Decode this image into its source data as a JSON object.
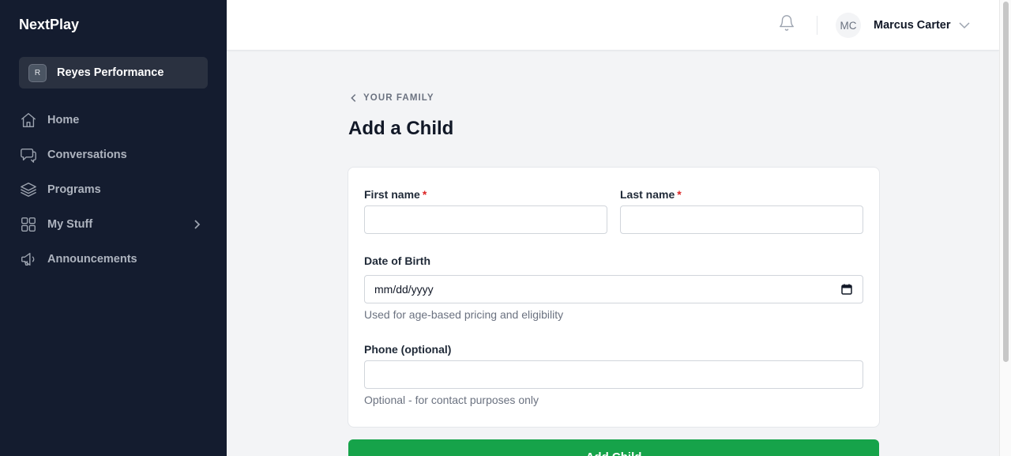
{
  "app": {
    "brand": "NextPlay",
    "organization": {
      "initial": "R",
      "name": "Reyes Performance"
    }
  },
  "sidebar": {
    "items": [
      {
        "label": "Home",
        "icon": "home-icon"
      },
      {
        "label": "Conversations",
        "icon": "chat-bubbles-icon"
      },
      {
        "label": "Programs",
        "icon": "layers-icon"
      },
      {
        "label": "My Stuff",
        "icon": "grid-icon",
        "has_submenu": true
      },
      {
        "label": "Announcements",
        "icon": "megaphone-icon"
      }
    ]
  },
  "header": {
    "notifications_icon": "bell-icon",
    "user": {
      "initials": "MC",
      "name": "Marcus Carter"
    }
  },
  "page": {
    "back_label": "YOUR FAMILY",
    "title": "Add a Child"
  },
  "form": {
    "first_name": {
      "label": "First name",
      "required_mark": "*",
      "value": ""
    },
    "last_name": {
      "label": "Last name",
      "required_mark": "*",
      "value": ""
    },
    "dob": {
      "label": "Date of Birth",
      "placeholder": "mm/dd/yyyy",
      "help": "Used for age-based pricing and eligibility"
    },
    "phone": {
      "label": "Phone (optional)",
      "value": "",
      "help": "Optional - for contact purposes only"
    },
    "submit_label": "Add Child"
  },
  "colors": {
    "sidebar_bg": "#141c2f",
    "accent_green": "#16a34a",
    "required_red": "#dc2626"
  }
}
